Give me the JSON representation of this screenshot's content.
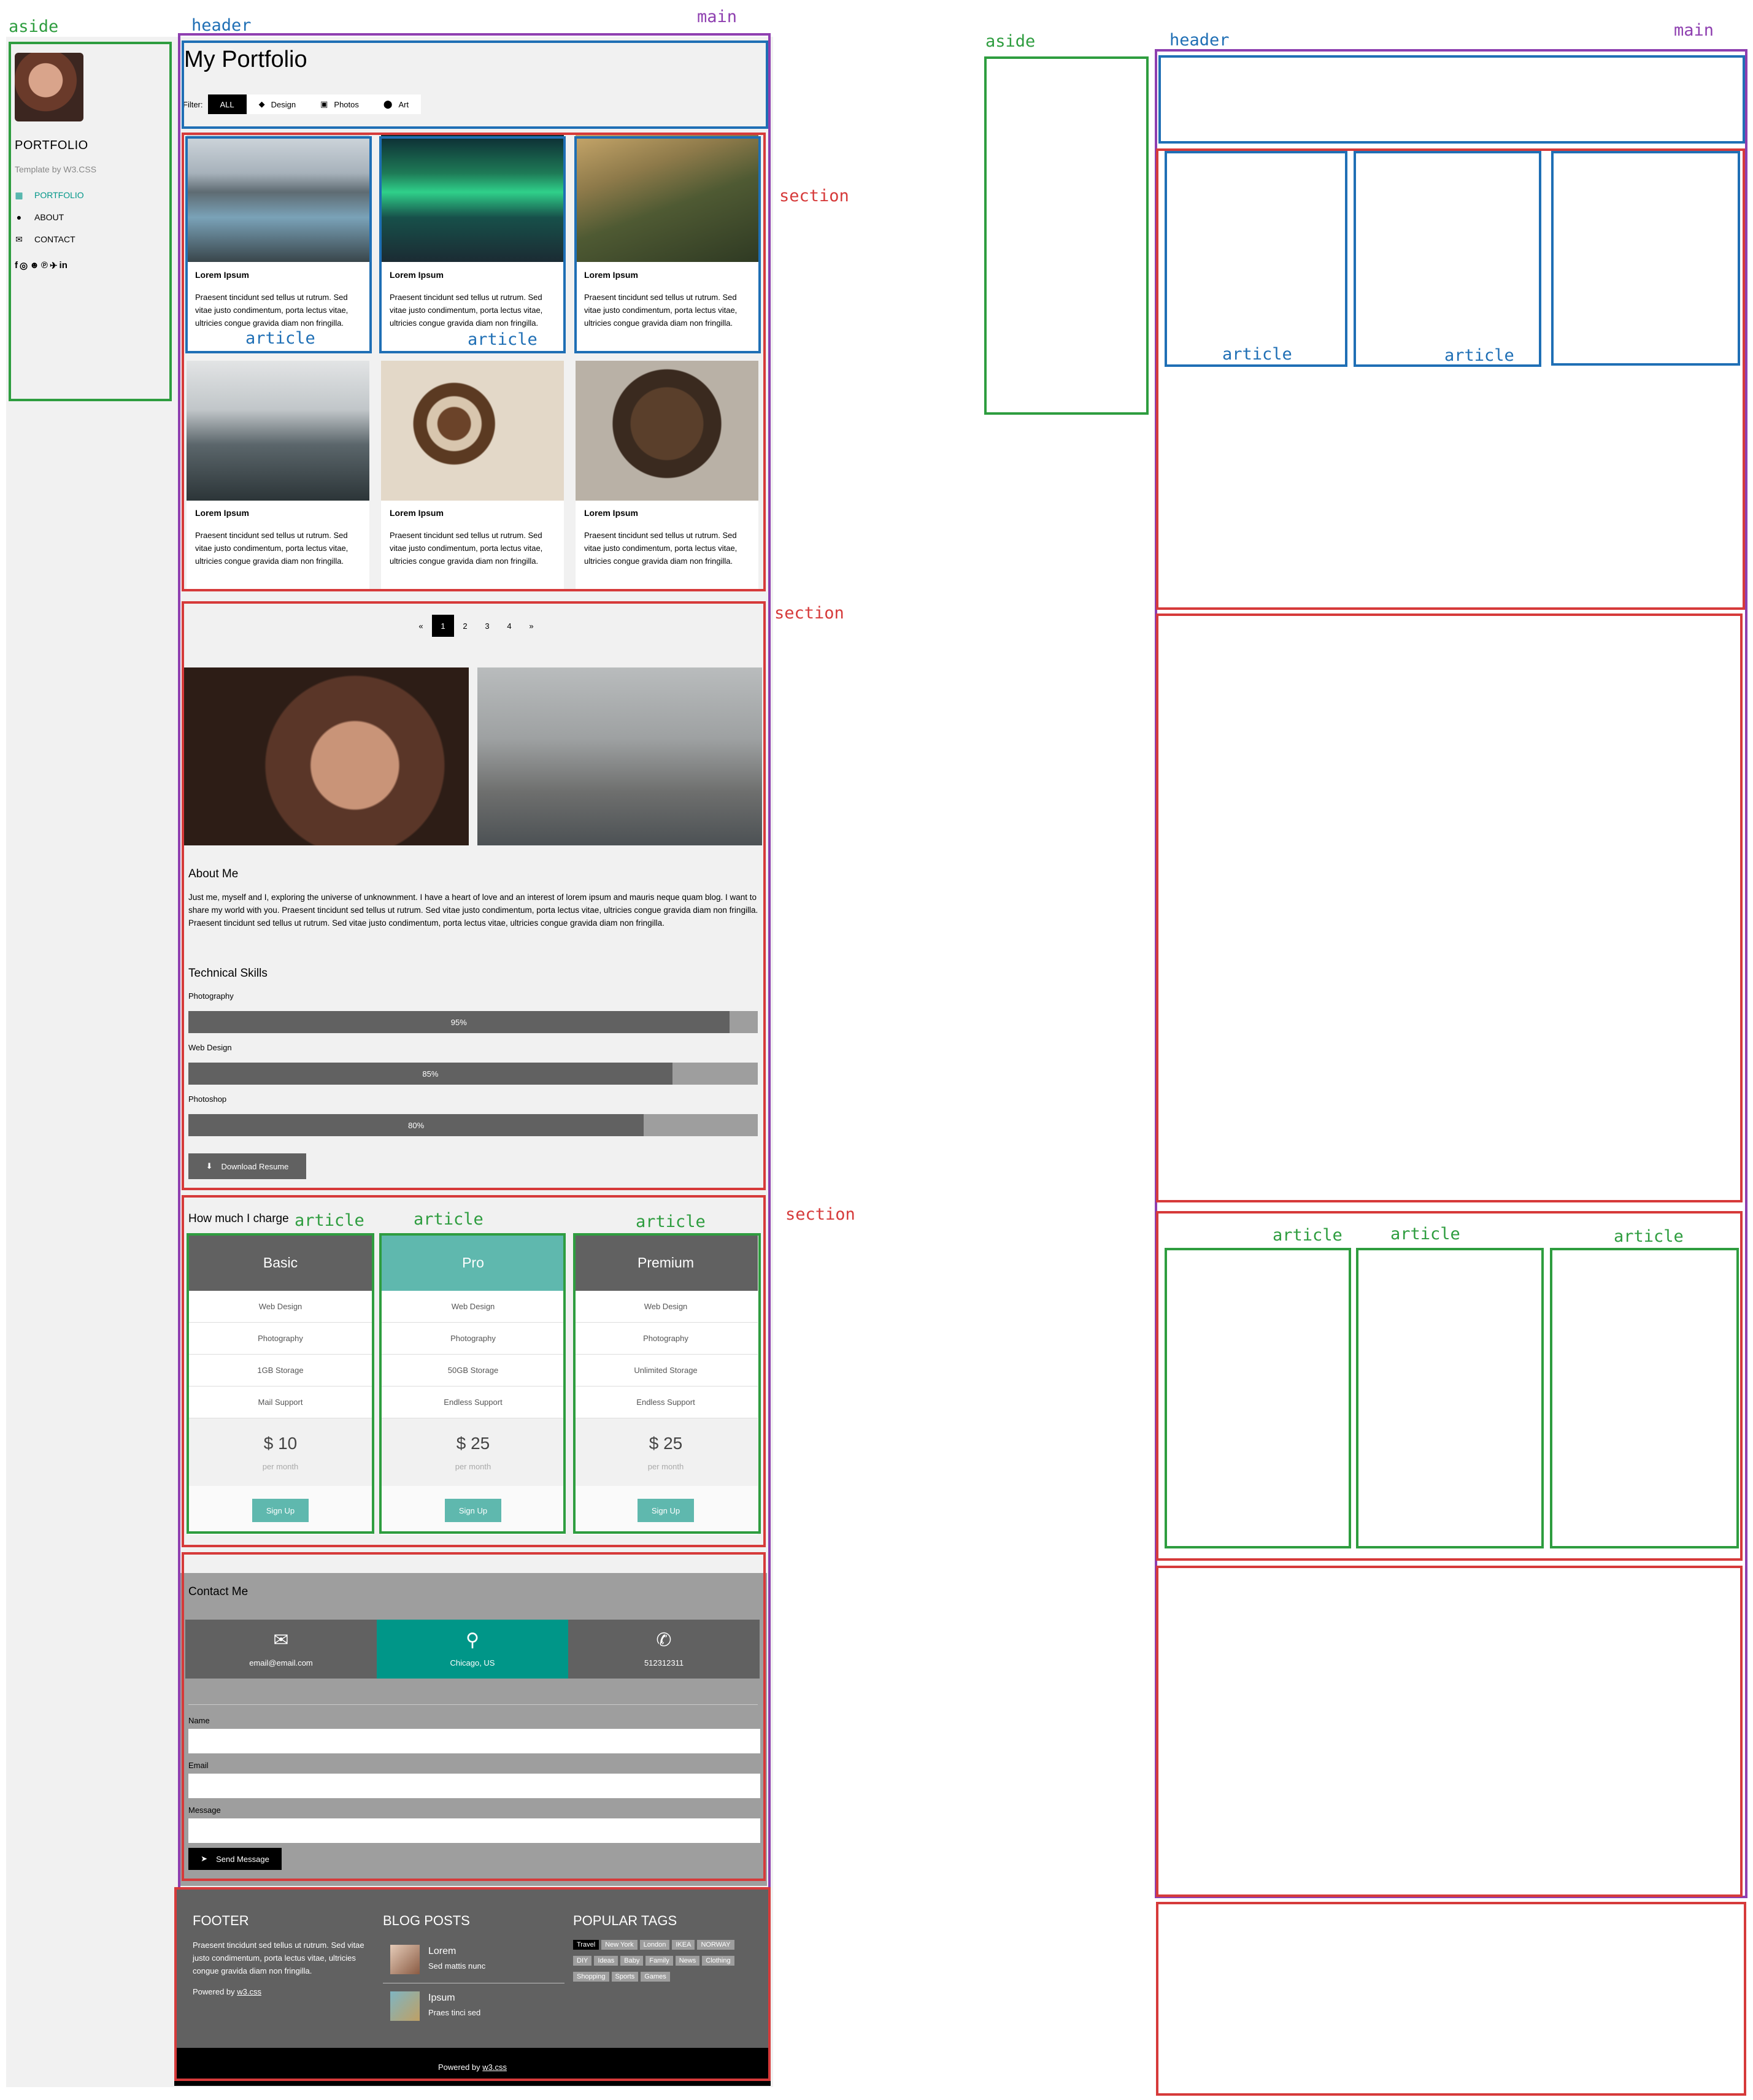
{
  "annotations": {
    "left": {
      "aside": "aside",
      "header": "header",
      "main": "main",
      "section1": "section",
      "section2": "section",
      "section3": "section",
      "article_portfolio_1": "article",
      "article_portfolio_2": "article",
      "article_plan_1": "article",
      "article_plan_2": "article",
      "article_plan_3": "article"
    },
    "right": {
      "aside": "aside",
      "header": "header",
      "main": "main",
      "article_1": "article",
      "article_2": "article",
      "article_3": "article",
      "article_4": "article",
      "article_5": "article"
    }
  },
  "sidebar": {
    "title": "PORTFOLIO",
    "subtitle": "Template by W3.CSS",
    "nav": [
      {
        "label": "PORTFOLIO",
        "icon": "grid-icon",
        "active": true
      },
      {
        "label": "ABOUT",
        "icon": "user-icon",
        "active": false
      },
      {
        "label": "CONTACT",
        "icon": "envelope-icon",
        "active": false
      }
    ],
    "social": [
      "facebook-icon",
      "instagram-icon",
      "snapchat-icon",
      "pinterest-icon",
      "twitter-icon",
      "linkedin-icon"
    ]
  },
  "header": {
    "title": "My Portfolio",
    "filter_label": "Filter:",
    "filters": [
      {
        "label": "ALL",
        "icon": "",
        "active": true
      },
      {
        "label": "Design",
        "icon": "diamond-icon",
        "active": false
      },
      {
        "label": "Photos",
        "icon": "photo-icon",
        "active": false
      },
      {
        "label": "Art",
        "icon": "map-marker-icon",
        "active": false
      }
    ]
  },
  "portfolio": {
    "items": [
      {
        "title": "Lorem Ipsum",
        "text": "Praesent tincidunt sed tellus ut rutrum. Sed vitae justo condimentum, porta lectus vitae, ultricies congue gravida diam non fringilla.",
        "image": "mountain-lake"
      },
      {
        "title": "Lorem Ipsum",
        "text": "Praesent tincidunt sed tellus ut rutrum. Sed vitae justo condimentum, porta lectus vitae, ultricies congue gravida diam non fringilla.",
        "image": "northern-lights"
      },
      {
        "title": "Lorem Ipsum",
        "text": "Praesent tincidunt sed tellus ut rutrum. Sed vitae justo condimentum, porta lectus vitae, ultricies congue gravida diam non fringilla.",
        "image": "mountain-river"
      },
      {
        "title": "Lorem Ipsum",
        "text": "Praesent tincidunt sed tellus ut rutrum. Sed vitae justo condimentum, porta lectus vitae, ultricies congue gravida diam non fringilla.",
        "image": "misty-forest"
      },
      {
        "title": "Lorem Ipsum",
        "text": "Praesent tincidunt sed tellus ut rutrum. Sed vitae justo condimentum, porta lectus vitae, ultricies congue gravida diam non fringilla.",
        "image": "coffee-beans"
      },
      {
        "title": "Lorem Ipsum",
        "text": "Praesent tincidunt sed tellus ut rutrum. Sed vitae justo condimentum, porta lectus vitae, ultricies congue gravida diam non fringilla.",
        "image": "bear"
      }
    ]
  },
  "pagination": {
    "prev": "«",
    "pages": [
      "1",
      "2",
      "3",
      "4"
    ],
    "active": "1",
    "next": "»"
  },
  "about": {
    "title": "About Me",
    "text": "Just me, myself and I, exploring the universe of unknownment. I have a heart of love and an interest of lorem ipsum and mauris neque quam blog. I want to share my world with you. Praesent tincidunt sed tellus ut rutrum. Sed vitae justo condimentum, porta lectus vitae, ultricies congue gravida diam non fringilla. Praesent tincidunt sed tellus ut rutrum. Sed vitae justo condimentum, porta lectus vitae, ultricies congue gravida diam non fringilla."
  },
  "skills": {
    "title": "Technical Skills",
    "items": [
      {
        "label": "Photography",
        "percent": 95,
        "text": "95%"
      },
      {
        "label": "Web Design",
        "percent": 85,
        "text": "85%"
      },
      {
        "label": "Photoshop",
        "percent": 80,
        "text": "80%"
      }
    ],
    "download_label": "Download Resume"
  },
  "pricing": {
    "title": "How much I charge",
    "plans": [
      {
        "name": "Basic",
        "color": "#616161",
        "features": [
          "Web Design",
          "Photography",
          "1GB Storage",
          "Mail Support"
        ],
        "price": "$ 10",
        "period": "per month",
        "cta": "Sign Up"
      },
      {
        "name": "Pro",
        "color": "#5fb8ae",
        "features": [
          "Web Design",
          "Photography",
          "50GB Storage",
          "Endless Support"
        ],
        "price": "$ 25",
        "period": "per month",
        "cta": "Sign Up"
      },
      {
        "name": "Premium",
        "color": "#616161",
        "features": [
          "Web Design",
          "Photography",
          "Unlimited Storage",
          "Endless Support"
        ],
        "price": "$ 25",
        "period": "per month",
        "cta": "Sign Up"
      }
    ]
  },
  "contact": {
    "title": "Contact Me",
    "boxes": [
      {
        "icon": "envelope-icon",
        "text": "email@email.com",
        "color": "#616161"
      },
      {
        "icon": "map-marker-icon",
        "text": "Chicago, US",
        "color": "#009688"
      },
      {
        "icon": "phone-icon",
        "text": "512312311",
        "color": "#616161"
      }
    ],
    "fields": [
      "Name",
      "Email",
      "Message"
    ],
    "send_label": "Send Message"
  },
  "footer": {
    "col1_title": "FOOTER",
    "col1_text": "Praesent tincidunt sed tellus ut rutrum. Sed vitae justo condimentum, porta lectus vitae, ultricies congue gravida diam non fringilla.",
    "powered_prefix": "Powered by",
    "powered_link": "w3.css",
    "col2_title": "BLOG POSTS",
    "posts": [
      {
        "title": "Lorem",
        "sub": "Sed mattis nunc"
      },
      {
        "title": "Ipsum",
        "sub": "Praes tinci sed"
      }
    ],
    "col3_title": "POPULAR TAGS",
    "tags": [
      "Travel",
      "New York",
      "London",
      "IKEA",
      "NORWAY",
      "DIY",
      "Ideas",
      "Baby",
      "Family",
      "News",
      "Clothing",
      "Shopping",
      "Sports",
      "Games"
    ],
    "bottom_prefix": "Powered by",
    "bottom_link": "w3.css"
  },
  "colors": {
    "accent": "#009688",
    "annotation_green": "#2e9d3f",
    "annotation_blue": "#1f6fb5",
    "annotation_purple": "#8e3fb0",
    "annotation_red": "#d63a3a"
  }
}
